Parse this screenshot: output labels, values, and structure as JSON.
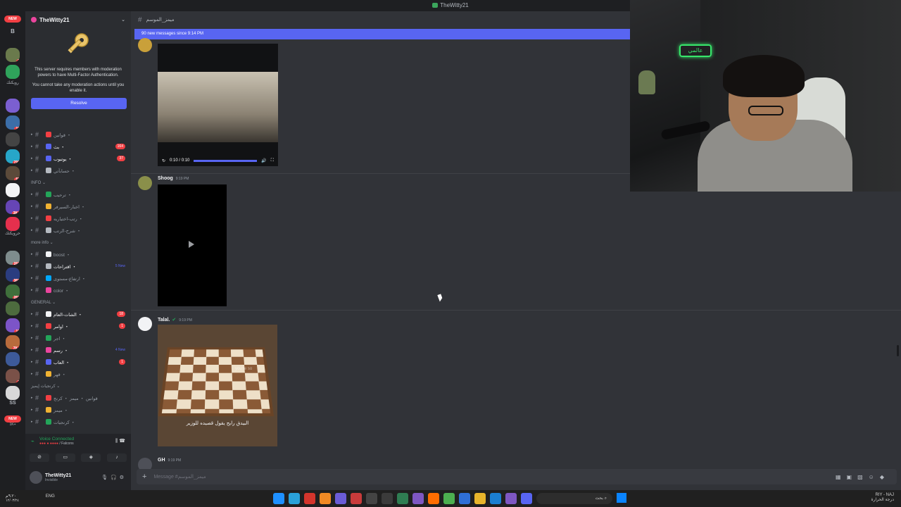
{
  "window": {
    "title": "TheWitty21"
  },
  "rail": {
    "top_new": "NEW",
    "b_label": "B",
    "ss_label": "SS",
    "mid_text": "رويكنك",
    "mid_text2": "حرويكنك",
    "bottom_new": "NEW",
    "bottom_new_sub": "1K+",
    "servers": [
      {
        "color": "#6a7a4c",
        "badge": "3"
      },
      {
        "color": "#2fa35b",
        "badge": ""
      },
      {
        "color": "#7b5fd1",
        "badge": ""
      },
      {
        "color": "#3c6ea8",
        "badge": "16"
      },
      {
        "color": "#444",
        "badge": ""
      },
      {
        "color": "#27a6c9",
        "badge": "791"
      },
      {
        "color": "#5b4a3a",
        "badge": "62"
      },
      {
        "color": "#f2f3f5",
        "badge": ""
      },
      {
        "color": "#6645b5",
        "badge": "3K+"
      },
      {
        "color": "#e5304d",
        "badge": ""
      },
      {
        "color": "#7e8c8d",
        "badge": "266"
      },
      {
        "color": "#2b3d80",
        "badge": "360"
      },
      {
        "color": "#3f6f3b",
        "badge": "260"
      },
      {
        "color": "#4d6b3e",
        "badge": ""
      },
      {
        "color": "#7c54c8",
        "badge": "17"
      },
      {
        "color": "#b86b3c",
        "badge": "7K+"
      },
      {
        "color": "#3d5a99",
        "badge": ""
      },
      {
        "color": "#7a5148",
        "badge": "7"
      },
      {
        "color": "#d8d8d8",
        "badge": ""
      }
    ]
  },
  "sidebar": {
    "server_name": "TheWitty21",
    "mfa_text": "This server requires members with moderation powers to have Multi-Factor Authentication.",
    "mfa_text2": "You cannot take any moderation actions until you enable it.",
    "resolve_label": "Resolve",
    "channels_top": [
      {
        "name": "قوانين ・",
        "emo": "#f23f43",
        "count": "",
        "new": ""
      },
      {
        "name": "بث ・",
        "emo": "#5865f2",
        "count": "164",
        "new": ""
      },
      {
        "name": "يوتيوب ・",
        "emo": "#5865f2",
        "count": "37",
        "new": ""
      },
      {
        "name": "حسابآتي ・",
        "emo": "#b5bac1",
        "count": "",
        "new": ""
      }
    ],
    "cat_info": "INFO",
    "channels_info": [
      {
        "name": "ترحيب ・",
        "emo": "#23a559",
        "count": "",
        "new": ""
      },
      {
        "name": "اخبار-السيرفر ・",
        "emo": "#f0b232",
        "count": "",
        "new": ""
      },
      {
        "name": "رتب-اختياريه ・",
        "emo": "#f23f43",
        "count": "",
        "new": ""
      },
      {
        "name": "شرح-الرتب ・",
        "emo": "#b5bac1",
        "count": "",
        "new": ""
      }
    ],
    "cat_more": "more info",
    "channels_more": [
      {
        "name": "boost ・",
        "emo": "#f2f3f5",
        "count": "",
        "new": ""
      },
      {
        "name": "اقتراحات ・",
        "emo": "#b5bac1",
        "count": "",
        "new": "5 New"
      },
      {
        "name": "ارتفاع-مستوى ・",
        "emo": "#00a8fc",
        "count": "",
        "new": ""
      },
      {
        "name": "color ・",
        "emo": "#eb459e",
        "count": "",
        "new": ""
      }
    ],
    "cat_general": "GENERAL",
    "channels_general": [
      {
        "name": "الشات-العام ・",
        "emo": "#f2f3f5",
        "count": "18",
        "new": ""
      },
      {
        "name": "اوامر ・",
        "emo": "#f23f43",
        "count": "1",
        "new": ""
      },
      {
        "name": "اجر ・",
        "emo": "#23a559",
        "count": "",
        "new": ""
      },
      {
        "name": "رسم ・",
        "emo": "#eb459e",
        "count": "",
        "new": "4 New"
      },
      {
        "name": "العاب ・",
        "emo": "#5865f2",
        "count": "1",
        "new": ""
      },
      {
        "name": "قهر ・",
        "emo": "#f0b232",
        "count": "",
        "new": ""
      }
    ],
    "cat_clips": "كرنجيات إيميز",
    "channels_clips": [
      {
        "name": "قوانين ・ ميمز ・ كرنج",
        "emo": "#f23f43",
        "count": "",
        "new": ""
      },
      {
        "name": "ميمز ・",
        "emo": "#f0b232",
        "count": "",
        "new": ""
      },
      {
        "name": "كرنجيات ・",
        "emo": "#23a559",
        "count": "",
        "new": ""
      }
    ]
  },
  "voice": {
    "status": "Voice Connected",
    "channel": "/ Falcons"
  },
  "user": {
    "name": "TheWitty21",
    "status": "Invisible"
  },
  "chat": {
    "channel_name": "ميمز_الموسم",
    "new_messages_bar": "90 new messages since 9:14 PM",
    "video1_time": "0:10 / 0:10",
    "video1_progress": 1.0,
    "msg2_author": "Shoog",
    "msg2_time": "9:19 PM",
    "msg3_author": "Talal.",
    "msg3_time": "9:19 PM",
    "msg3_caption": "البيدق رايح يقول قصيده للوزير",
    "msg3_watermark": "you're so",
    "msg4_author": "GH",
    "msg4_time": "9:19 PM",
    "composer_placeholder": "Message #ميمز_الموسم"
  },
  "webcam": {
    "neon_sign": "عالمي"
  },
  "taskbar": {
    "clock_left": "٩:٢٠م",
    "date_left": "١٢/٠٣/٢٤",
    "lang": "ENG",
    "search_placeholder": "بحث",
    "weather_line1": "RIY - NAJ",
    "weather_line2": "درجة الحرارة",
    "app_colors": [
      "#1e90ff",
      "#2aa1d8",
      "#d4352c",
      "#f08a24",
      "#6a5cd6",
      "#c93b3b",
      "#444",
      "#3b3b3b",
      "#2f7d52",
      "#7e57c2",
      "#ff6d00",
      "#4caf50",
      "#2f6fd6",
      "#e8b52b",
      "#1b7fd1",
      "#7e57c2",
      "#5865f2"
    ]
  }
}
